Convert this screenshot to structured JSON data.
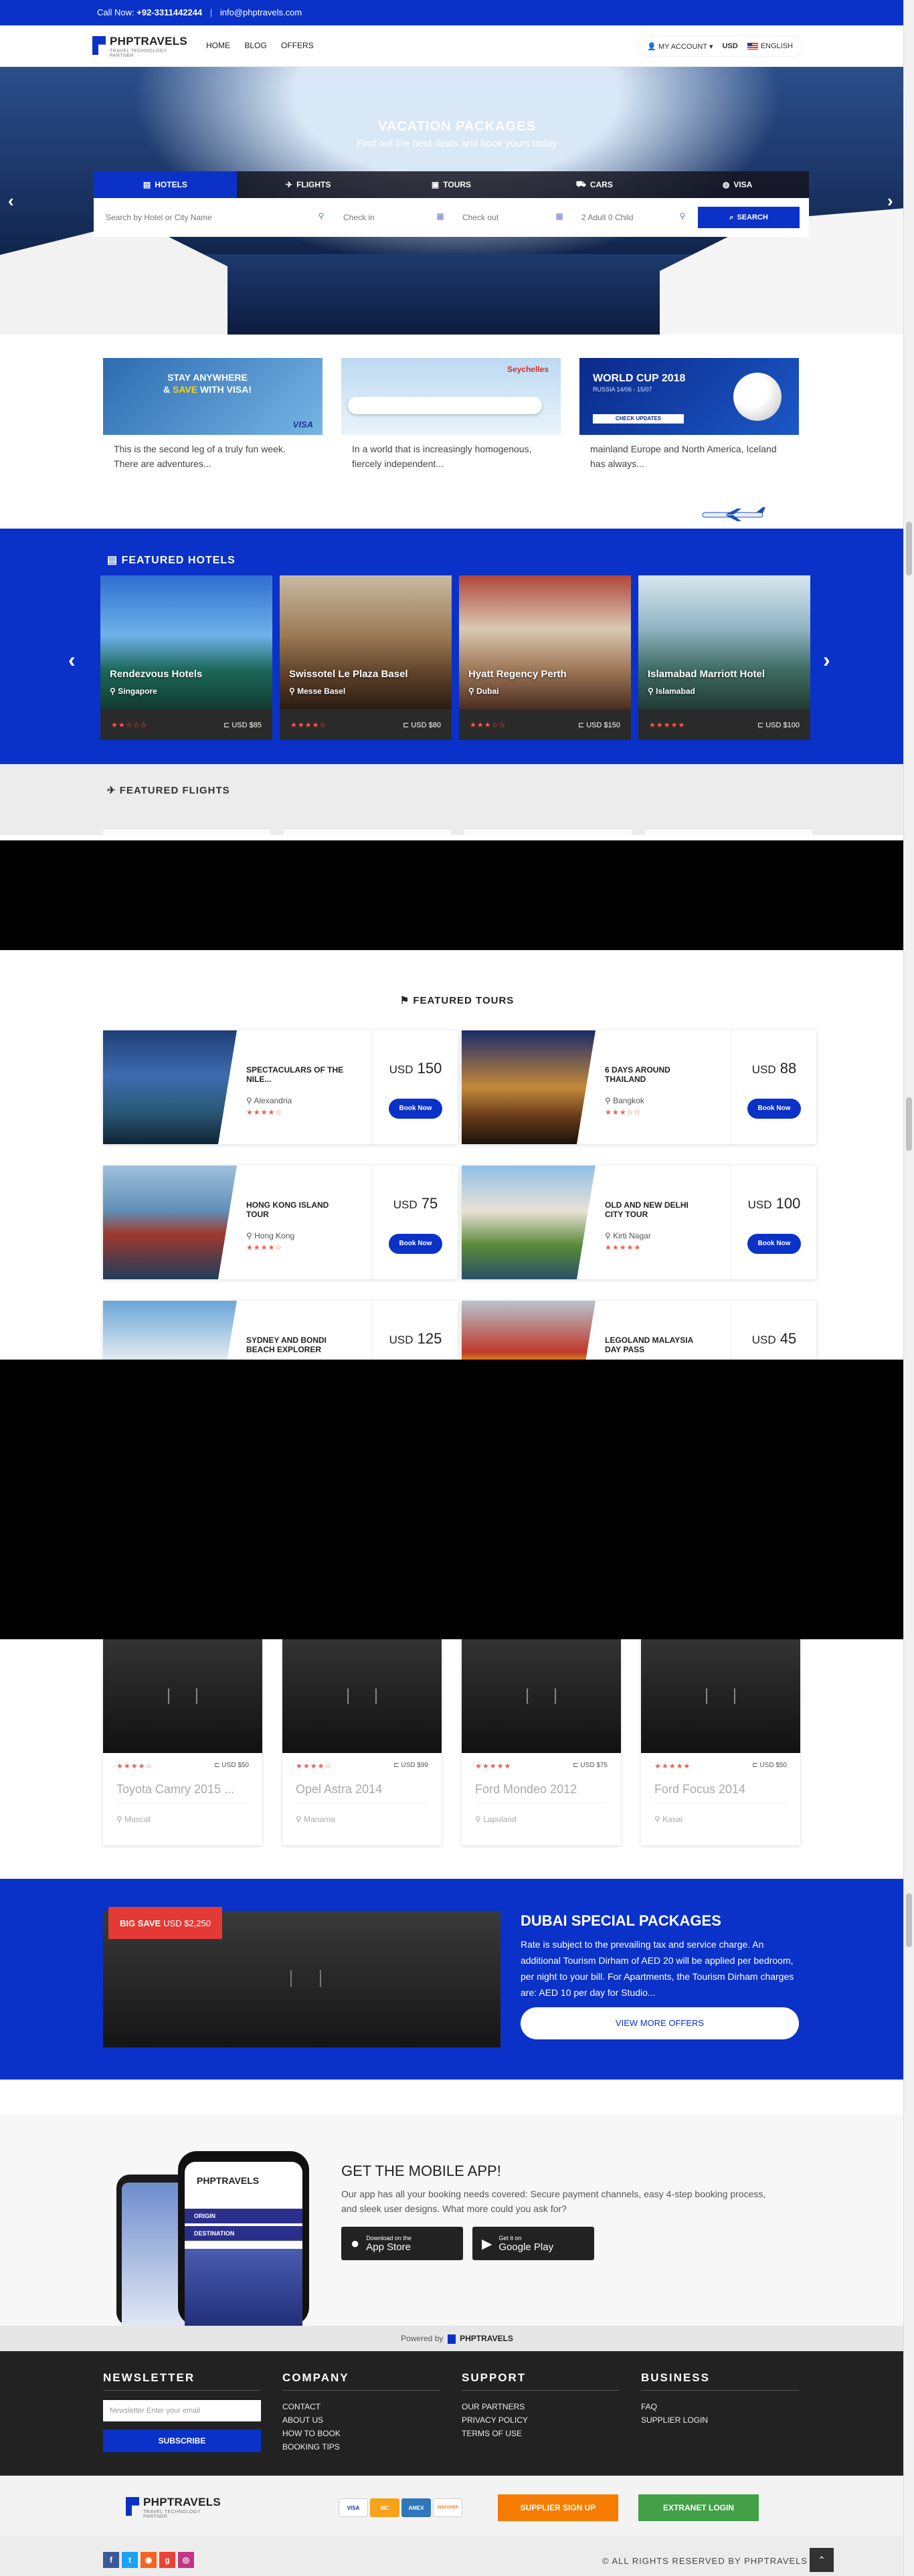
{
  "topbar": {
    "call_label": "Call Now:",
    "phone": "+92-3311442244",
    "email": "info@phptravels.com"
  },
  "nav": {
    "logo_name": "PHPTRAVELS",
    "logo_tag": "TRAVEL TECHNOLOGY PARTNER",
    "menu": [
      "HOME",
      "BLOG",
      "OFFERS"
    ],
    "account": "MY ACCOUNT",
    "currency": "USD",
    "language": "ENGLISH"
  },
  "hero": {
    "title": "VACATION PACKAGES",
    "subtitle": "Find out the best deals and book yours today",
    "tabs": [
      "HOTELS",
      "FLIGHTS",
      "TOURS",
      "CARS",
      "VISA"
    ],
    "search_placeholder": "Search by Hotel or City Name",
    "checkin": "Check in",
    "checkout": "Check out",
    "guests": "2 Adult 0 Child",
    "search_btn": "SEARCH"
  },
  "offers": [
    {
      "headline1": "STAY ANYWHERE",
      "headline2a": "& ",
      "headline2b": "SAVE",
      "headline2c": " WITH VISA!",
      "brand": "VISA",
      "text": "This is the second leg of a truly fun week. There are adventures..."
    },
    {
      "brand": "Seychelles",
      "text": "In a world that is increasingly homogenous, fiercely independent..."
    },
    {
      "headline1": "WORLD CUP 2018",
      "sub": "RUSSIA 14/06 - 15/07",
      "cta": "CHECK UPDATES",
      "text": "mainland Europe and North America, Iceland has always..."
    }
  ],
  "featured_hotels": {
    "title": "FEATURED HOTELS",
    "items": [
      {
        "name": "Rendezvous Hotels",
        "location": "Singapore",
        "stars": "★★☆☆☆",
        "price": "USD $85"
      },
      {
        "name": "Swissotel Le Plaza Basel",
        "location": "Messe Basel",
        "stars": "★★★★☆",
        "price": "USD $80"
      },
      {
        "name": "Hyatt Regency Perth",
        "location": "Dubai",
        "stars": "★★★☆☆",
        "price": "USD $150"
      },
      {
        "name": "Islamabad Marriott Hotel",
        "location": "Islamabad",
        "stars": "★★★★★",
        "price": "USD $100"
      }
    ]
  },
  "featured_flights": {
    "title": "FEATURED FLIGHTS"
  },
  "featured_tours": {
    "title": "FEATURED TOURS",
    "items": [
      {
        "name": "SPECTACULARS OF THE NILE...",
        "location": "Alexandria",
        "stars": "★★★★☆",
        "currency": "USD",
        "price": "150",
        "btn": "Book Now"
      },
      {
        "name": "6 DAYS AROUND THAILAND",
        "location": "Bangkok",
        "stars": "★★★☆☆",
        "currency": "USD",
        "price": "88",
        "btn": "Book Now"
      },
      {
        "name": "HONG KONG ISLAND TOUR",
        "location": "Hong Kong",
        "stars": "★★★★☆",
        "currency": "USD",
        "price": "75",
        "btn": "Book Now"
      },
      {
        "name": "OLD AND NEW DELHI CITY TOUR",
        "location": "Kirti Nagar",
        "stars": "★★★★★",
        "currency": "USD",
        "price": "100",
        "btn": "Book Now"
      },
      {
        "name": "SYDNEY AND BONDI BEACH EXPLORER",
        "location": "",
        "stars": "",
        "currency": "USD",
        "price": "125",
        "btn": ""
      },
      {
        "name": "LEGOLAND MALAYSIA DAY PASS",
        "location": "",
        "stars": "",
        "currency": "USD",
        "price": "45",
        "btn": ""
      }
    ]
  },
  "featured_cars": {
    "items": [
      {
        "stars": "★★★★☆",
        "price": "USD $50",
        "name": "Toyota Camry 2015 ...",
        "location": "Muscat"
      },
      {
        "stars": "★★★★☆",
        "price": "USD $99",
        "name": "Opel Astra 2014",
        "location": "Manama"
      },
      {
        "stars": "★★★★★",
        "price": "USD $75",
        "name": "Ford Mondeo 2012",
        "location": "Lapuland"
      },
      {
        "stars": "★★★★★",
        "price": "USD $50",
        "name": "Ford Focus 2014",
        "location": "Kasai"
      }
    ]
  },
  "dubai": {
    "badge_big": "BIG SAVE",
    "badge_price": "USD $2,250",
    "title": "DUBAI SPECIAL PACKAGES",
    "desc": "Rate is subject to the prevailing tax and service charge. An additional Tourism Dirham of AED 20 will be applied per bedroom, per night to your bill. For Apartments, the Tourism Dirham charges are: AED 10 per day for Studio...",
    "btn": "VIEW MORE OFFERS"
  },
  "app": {
    "title": "GET THE MOBILE APP!",
    "desc": "Our app has all your booking needs covered: Secure payment channels, easy 4-step booking process, and sleek user designs. What more could you ask for?",
    "appstore_small": "Download on the",
    "appstore_big": "App Store",
    "play_small": "Get it on",
    "play_big": "Google Play",
    "phone_logo": "PHPTRAVELS",
    "phone_rows": [
      "ORIGIN",
      "DESTINATION"
    ]
  },
  "powered": {
    "label": "Powered by",
    "brand": "PHPTRAVELS"
  },
  "footer": {
    "newsletter": {
      "title": "NEWSLETTER",
      "placeholder": "Newsletter Enter your email",
      "btn": "SUBSCRIBE"
    },
    "company": {
      "title": "COMPANY",
      "links": [
        "CONTACT",
        "ABOUT US",
        "HOW TO BOOK",
        "BOOKING TIPS"
      ]
    },
    "support": {
      "title": "SUPPORT",
      "links": [
        "OUR PARTNERS",
        "PRIVACY POLICY",
        "TERMS OF USE"
      ]
    },
    "business": {
      "title": "BUSINESS",
      "links": [
        "FAQ",
        "SUPPLIER LOGIN"
      ]
    }
  },
  "footer2": {
    "cards": [
      "VISA",
      "MC",
      "AMEX",
      "DISCOVER"
    ],
    "supplier_btn": "SUPPLIER SIGN UP",
    "extranet_btn": "EXTRANET LOGIN"
  },
  "bottom": {
    "copyright": "© ALL RIGHTS RESERVED BY PHPTRAVELS"
  },
  "colors": {
    "primary": "#0a32c8",
    "accent_red": "#e53935",
    "orange": "#f57c00",
    "green": "#43a047",
    "dark": "#222222"
  }
}
